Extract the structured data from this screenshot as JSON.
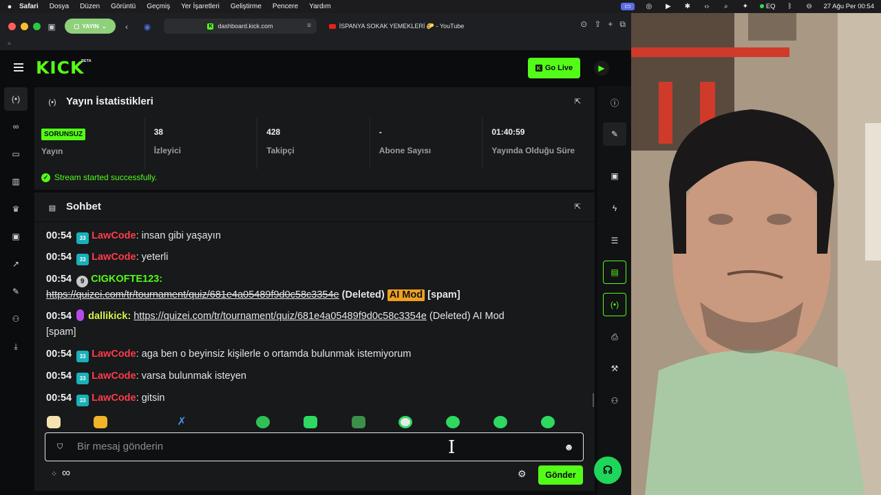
{
  "menubar": {
    "app": "Safari",
    "items": [
      "Dosya",
      "Düzen",
      "Görüntü",
      "Geçmiş",
      "Yer İşaretleri",
      "Geliştirme",
      "Pencere",
      "Yardım"
    ],
    "eq_label": "EQ",
    "clock": "27 Ağu Per  00:54"
  },
  "safari": {
    "profile_label": "YAYIN",
    "active_tab": "dashboard.kick.com",
    "other_tab": "İSPANYA SOKAK YEMEKLERİ 🌮 - YouTube"
  },
  "header": {
    "logo": "KICK",
    "logo_badge": "BETA",
    "go_live": "Go Live"
  },
  "stats": {
    "title": "Yayın İstatistikleri",
    "status_badge": "SORUNSUZ",
    "status_label": "Yayın",
    "items": [
      {
        "value": "38",
        "label": "İzleyici"
      },
      {
        "value": "428",
        "label": "Takipçi"
      },
      {
        "value": "-",
        "label": "Abone Sayısı"
      },
      {
        "value": "01:40:59",
        "label": "Yayında Olduğu Süre"
      }
    ],
    "message": "Stream started successfully."
  },
  "chat": {
    "title": "Sohbet",
    "messages": [
      {
        "time": "00:54",
        "badge": "33",
        "user": "LawCode",
        "text": ": insan gibi yaşayın"
      },
      {
        "time": "00:54",
        "badge": "33",
        "user": "LawCode",
        "text": ": yeterli"
      },
      {
        "time": "00:54",
        "badge": "9",
        "user": "CIGKOFTE123",
        "text": ":",
        "link": "https://quizei.com/tr/tournament/quiz/681e4a05489f9d0c58c3354e",
        "deleted": "(Deleted)",
        "mod": "AI Mod",
        "reason": "[spam]"
      },
      {
        "time": "00:54",
        "user": "dallikick",
        "text": ":",
        "link": "https://quizei.com/tr/tournament/quiz/681e4a05489f9d0c58c3354e",
        "tail": "(Deleted) AI Mod",
        "reason": "[spam]"
      },
      {
        "time": "00:54",
        "badge": "33",
        "user": "LawCode",
        "text": ": aga ben o beyinsiz kişilerle o ortamda bulunmak istemiyorum"
      },
      {
        "time": "00:54",
        "badge": "33",
        "user": "LawCode",
        "text": ": varsa bulunmak isteyen"
      },
      {
        "time": "00:54",
        "badge": "33",
        "user": "LawCode",
        "text": ": gitsin"
      }
    ],
    "input_placeholder": "Bir mesaj gönderin",
    "send_label": "Gönder"
  },
  "colors": {
    "brand": "#53fc18",
    "lawcode": "#ff3b4a",
    "sub_badge": "#1ab0b8",
    "ai_mod": "#f0a020"
  },
  "icons": {
    "left_rail": [
      "broadcast-icon",
      "link-icon",
      "window-icon",
      "chart-icon",
      "trophy-icon",
      "film-icon",
      "growth-icon",
      "wrench-icon",
      "users-icon",
      "download-icon"
    ],
    "right_rail": [
      "info-icon",
      "pen-icon",
      "film-icon",
      "bolt-icon",
      "list-icon",
      "chat-icon",
      "broadcast-icon",
      "print-icon",
      "wrench-icon",
      "users-icon"
    ]
  }
}
